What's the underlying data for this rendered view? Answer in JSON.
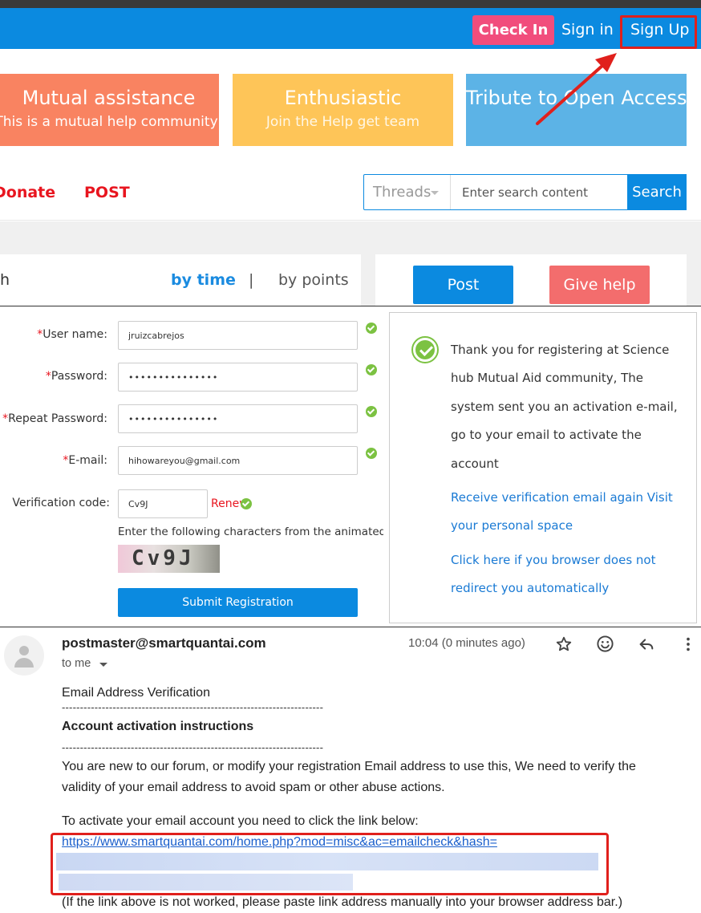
{
  "header": {
    "checkin_label": "Check In",
    "signin_label": "Sign in",
    "signup_label": "Sign Up"
  },
  "banners": [
    {
      "title": "Mutual assistance",
      "subtitle": "This is a mutual help community",
      "color": "#f98361"
    },
    {
      "title": "Enthusiastic",
      "subtitle": "Join the Help get team",
      "color": "#fec558"
    },
    {
      "title": "Tribute to Open Access",
      "subtitle": "",
      "color": "#5cb3e6"
    }
  ],
  "nav": {
    "donate_label": "Donate",
    "post_label": "POST",
    "search_scope": "Threads",
    "search_placeholder": "Enter search content",
    "search_button": "Search"
  },
  "sort": {
    "left_fragment": "h",
    "by_time": "by time",
    "separator": "|",
    "by_points": "by points"
  },
  "actions": {
    "post_label": "Post",
    "give_help_label": "Give help"
  },
  "form": {
    "required_mark": "*",
    "username_label": "User name:",
    "username_value": "jruizcabrejos",
    "password_label": "Password:",
    "password_value": "•••••••••••••••",
    "repeat_label": "Repeat Password:",
    "repeat_value": "•••••••••••••••",
    "email_label": "E-mail:",
    "email_value": "hihowareyou@gmail.com",
    "verif_label": "Verification code:",
    "verif_value": "Cv9J",
    "renew_label": "Renew",
    "hint": "Enter the following characters from the animated",
    "captcha_text": "Cv9J",
    "submit_label": "Submit Registration"
  },
  "thanks": {
    "message": "Thank you for registering at Science hub Mutual Aid community, The system sent you an activation e-mail, go to your email to activate the account",
    "link1": "Receive verification email again Visit your personal space",
    "link2": "Click here if you browser does not redirect you automatically"
  },
  "email": {
    "sender": "postmaster@smartquantai.com",
    "to": "to me",
    "time": "10:04 (0 minutes ago)",
    "subject_line": "Email Address Verification",
    "dashes": "------------------------------------------------------------------------",
    "instructions_title": "Account activation instructions",
    "para1_line1": "You are new to our forum, or modify your registration Email address to use this, We need to verify the",
    "para1_line2": "validity of your email address to avoid spam or other abuse actions.",
    "para2": "To activate your email account you need to click the link below:",
    "link": "https://www.smartquantai.com/home.php?mod=misc&ac=emailcheck&hash=",
    "footer": "(If the link above is not worked, please paste link address manually into your browser address bar.)",
    "icons": [
      "star-icon",
      "smiley-icon",
      "reply-icon",
      "more-vert-icon"
    ]
  },
  "colors": {
    "header_blue": "#0b8ae0",
    "checkin_pink": "#f14d7c",
    "annotation_red": "#e0201c",
    "check_green": "#7cc242"
  }
}
